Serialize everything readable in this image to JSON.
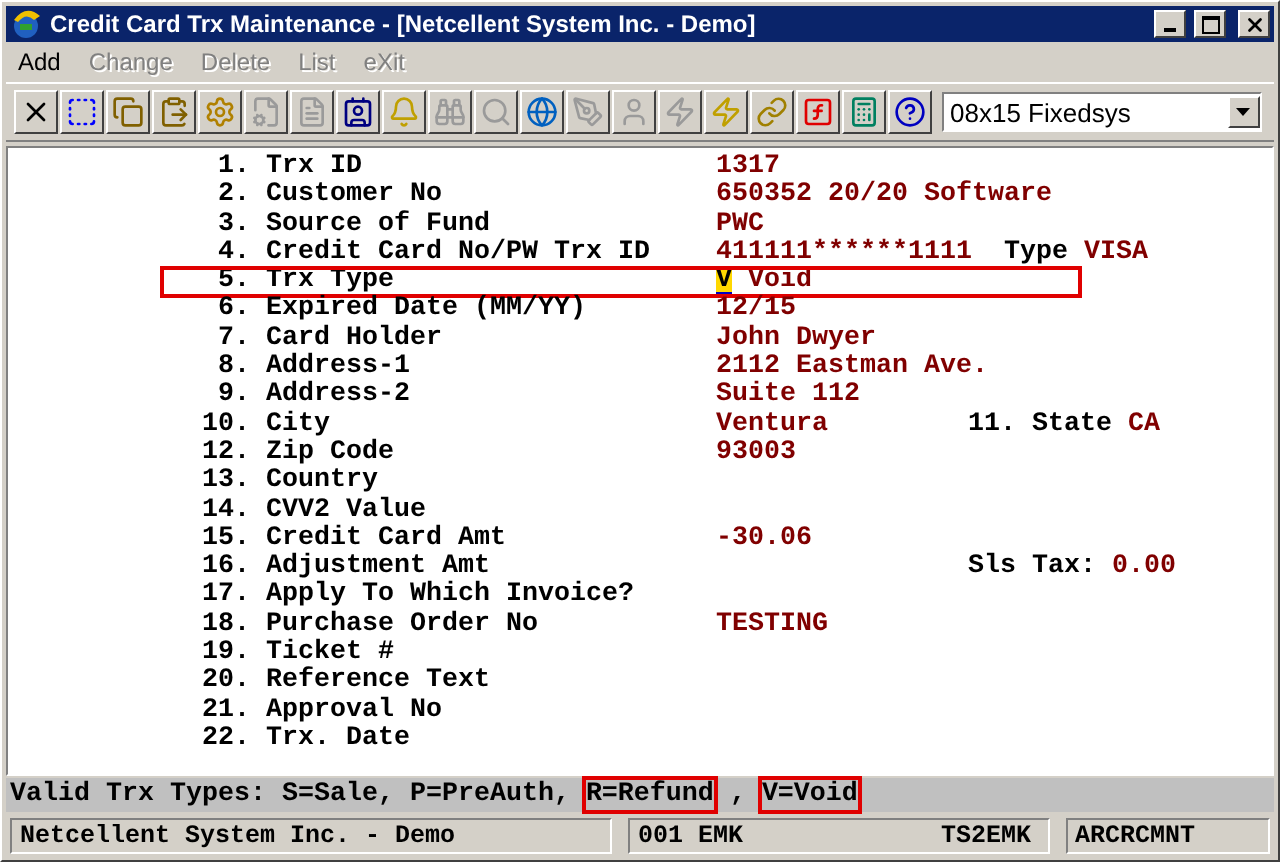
{
  "window": {
    "title": "Credit Card Trx Maintenance - [Netcellent System Inc. - Demo]"
  },
  "menu": [
    {
      "label": "Add",
      "disabled": false
    },
    {
      "label": "Change",
      "disabled": true
    },
    {
      "label": "Delete",
      "disabled": true
    },
    {
      "label": "List",
      "disabled": true
    },
    {
      "label": "eXit",
      "disabled": true
    }
  ],
  "toolbar": [
    {
      "kind": "close",
      "disabled": false
    },
    {
      "kind": "select",
      "disabled": false
    },
    {
      "kind": "copy",
      "disabled": false
    },
    {
      "kind": "paste",
      "disabled": false
    },
    {
      "kind": "gear",
      "disabled": false
    },
    {
      "kind": "properties",
      "disabled": true
    },
    {
      "kind": "document",
      "disabled": true
    },
    {
      "kind": "contact",
      "disabled": false
    },
    {
      "kind": "bell",
      "disabled": false
    },
    {
      "kind": "binoculars",
      "disabled": true
    },
    {
      "kind": "search",
      "disabled": true
    },
    {
      "kind": "globe",
      "disabled": false
    },
    {
      "kind": "pen",
      "disabled": true
    },
    {
      "kind": "person",
      "disabled": true
    },
    {
      "kind": "bolt",
      "disabled": true
    },
    {
      "kind": "bolt",
      "disabled": false
    },
    {
      "kind": "link",
      "disabled": false
    },
    {
      "kind": "function",
      "disabled": false
    },
    {
      "kind": "calculator",
      "disabled": false
    },
    {
      "kind": "help",
      "disabled": false
    }
  ],
  "font_select": {
    "value": "08x15 Fixedsys"
  },
  "fields": [
    {
      "num": "1.",
      "label": "Trx ID",
      "value": "1317"
    },
    {
      "num": "2.",
      "label": "Customer No",
      "value": "650352 20/20 Software"
    },
    {
      "num": "3.",
      "label": "Source of Fund",
      "value": "PWC"
    },
    {
      "num": "4.",
      "label": "Credit Card No/PW Trx ID",
      "value": "411111******1111",
      "extra": {
        "label": "Type",
        "value": "VISA"
      }
    },
    {
      "num": "5.",
      "label": "Trx Type",
      "cursor": "V",
      "value": "Void",
      "highlighted": true
    },
    {
      "num": "6.",
      "label": "Expired Date (MM/YY)",
      "value": "12/15"
    },
    {
      "num": "7.",
      "label": "Card Holder",
      "value": "John Dwyer"
    },
    {
      "num": "8.",
      "label": "Address-1",
      "value": "2112 Eastman Ave."
    },
    {
      "num": "9.",
      "label": "Address-2",
      "value": "Suite 112"
    },
    {
      "num": "10.",
      "label": "City",
      "value": "Ventura",
      "extra": {
        "label": "11. State",
        "value": "CA"
      }
    },
    {
      "num": "12.",
      "label": "Zip Code",
      "value": "93003"
    },
    {
      "num": "13.",
      "label": "Country"
    },
    {
      "num": "14.",
      "label": "CVV2 Value"
    },
    {
      "num": "15.",
      "label": "Credit Card Amt",
      "value": "-30.06"
    },
    {
      "num": "16.",
      "label": "Adjustment Amt",
      "extra": {
        "label": "Sls Tax:",
        "value": "0.00"
      }
    },
    {
      "num": "17.",
      "label": "Apply To Which Invoice?"
    },
    {
      "num": "18.",
      "label": "Purchase Order No",
      "value": "TESTING"
    },
    {
      "num": "19.",
      "label": "Ticket #"
    },
    {
      "num": "20.",
      "label": "Reference Text"
    },
    {
      "num": "21.",
      "label": "Approval No"
    },
    {
      "num": "22.",
      "label": "Trx. Date"
    }
  ],
  "hint": [
    {
      "text": "Valid Trx Types: S=Sale, P=PreAuth,",
      "highlighted": false
    },
    {
      "text": "R=Refund",
      "highlighted": true
    },
    {
      "text": ",",
      "highlighted": false
    },
    {
      "text": "V=Void",
      "highlighted": true
    }
  ],
  "status_bar": {
    "company": "Netcellent System Inc. - Demo",
    "user": "001 EMK",
    "terminal": "TS2EMK",
    "program": "ARCRCMNT"
  }
}
